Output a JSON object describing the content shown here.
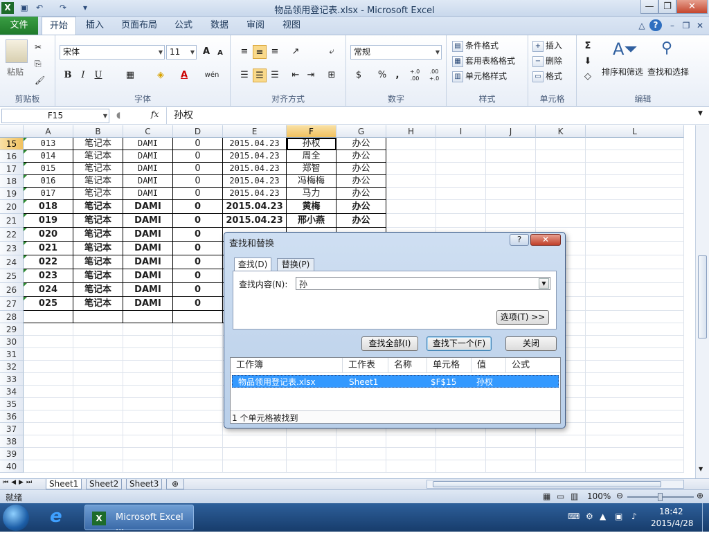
{
  "window": {
    "title": "物品领用登记表.xlsx - Microsoft Excel",
    "min_glyph": "—",
    "max_glyph": "❐",
    "close_glyph": "✕",
    "help_glyph": "?"
  },
  "ribbon_tabs": [
    "文件",
    "开始",
    "插入",
    "页面布局",
    "公式",
    "数据",
    "审阅",
    "视图"
  ],
  "ribbon": {
    "clipboard": {
      "label": "剪贴板",
      "paste": "粘贴"
    },
    "font": {
      "label": "字体",
      "font_name": "宋体",
      "font_size": "11",
      "bold": "B",
      "italic": "I",
      "underline": "U",
      "grow": "A",
      "shrink": "A",
      "font_color": "A",
      "phonetic": "wén"
    },
    "alignment": {
      "label": "对齐方式"
    },
    "number": {
      "label": "数字",
      "format": "常规",
      "percent": "%",
      "comma": ",",
      "inc_dec": "+.0 .00",
      "dec_dec": ".00 +.0"
    },
    "styles": {
      "label": "样式",
      "conditional": "条件格式",
      "table": "套用表格格式",
      "cell": "单元格样式"
    },
    "cells": {
      "label": "单元格",
      "insert": "插入",
      "delete": "删除",
      "format": "格式"
    },
    "editing": {
      "label": "编辑",
      "sum": "Σ",
      "sort": "排序和筛选",
      "find": "查找和选择"
    }
  },
  "formula_bar": {
    "name_box": "F15",
    "fx": "fx",
    "content": "孙权"
  },
  "columns": [
    "A",
    "B",
    "C",
    "D",
    "E",
    "F",
    "G",
    "H",
    "I",
    "J",
    "K",
    "L"
  ],
  "selected_column": "F",
  "rows": [
    {
      "n": "15",
      "cells": [
        "013",
        "笔记本",
        "DAMI",
        "0",
        "2015.04.23",
        "孙权",
        "办公"
      ],
      "bold": false
    },
    {
      "n": "16",
      "cells": [
        "014",
        "笔记本",
        "DAMI",
        "0",
        "2015.04.23",
        "周全",
        "办公"
      ],
      "bold": false
    },
    {
      "n": "17",
      "cells": [
        "015",
        "笔记本",
        "DAMI",
        "0",
        "2015.04.23",
        "郑智",
        "办公"
      ],
      "bold": false
    },
    {
      "n": "18",
      "cells": [
        "016",
        "笔记本",
        "DAMI",
        "0",
        "2015.04.23",
        "冯梅梅",
        "办公"
      ],
      "bold": false
    },
    {
      "n": "19",
      "cells": [
        "017",
        "笔记本",
        "DAMI",
        "0",
        "2015.04.23",
        "马力",
        "办公"
      ],
      "bold": false
    },
    {
      "n": "20",
      "cells": [
        "018",
        "笔记本",
        "DAMI",
        "0",
        "2015.04.23",
        "黄梅",
        "办公"
      ],
      "bold": true
    },
    {
      "n": "21",
      "cells": [
        "019",
        "笔记本",
        "DAMI",
        "0",
        "2015.04.23",
        "邢小燕",
        "办公"
      ],
      "bold": true
    },
    {
      "n": "22",
      "cells": [
        "020",
        "笔记本",
        "DAMI",
        "0",
        "",
        "",
        ""
      ],
      "bold": true
    },
    {
      "n": "23",
      "cells": [
        "021",
        "笔记本",
        "DAMI",
        "0",
        "",
        "",
        ""
      ],
      "bold": true
    },
    {
      "n": "24",
      "cells": [
        "022",
        "笔记本",
        "DAMI",
        "0",
        "",
        "",
        ""
      ],
      "bold": true
    },
    {
      "n": "25",
      "cells": [
        "023",
        "笔记本",
        "DAMI",
        "0",
        "",
        "",
        ""
      ],
      "bold": true
    },
    {
      "n": "26",
      "cells": [
        "024",
        "笔记本",
        "DAMI",
        "0",
        "",
        "",
        ""
      ],
      "bold": true
    },
    {
      "n": "27",
      "cells": [
        "025",
        "笔记本",
        "DAMI",
        "0",
        "",
        "",
        ""
      ],
      "bold": true
    },
    {
      "n": "28",
      "cells": [
        "",
        "",
        "",
        "",
        "",
        "",
        ""
      ],
      "bold": false
    },
    {
      "n": "29",
      "cells": [],
      "bold": false
    },
    {
      "n": "30",
      "cells": [],
      "bold": false
    },
    {
      "n": "31",
      "cells": [],
      "bold": false
    },
    {
      "n": "32",
      "cells": [],
      "bold": false
    },
    {
      "n": "33",
      "cells": [],
      "bold": false
    },
    {
      "n": "34",
      "cells": [],
      "bold": false
    },
    {
      "n": "35",
      "cells": [],
      "bold": false
    },
    {
      "n": "36",
      "cells": [],
      "bold": false
    },
    {
      "n": "37",
      "cells": [],
      "bold": false
    },
    {
      "n": "38",
      "cells": [],
      "bold": false
    },
    {
      "n": "39",
      "cells": [],
      "bold": false
    },
    {
      "n": "40",
      "cells": [],
      "bold": false
    }
  ],
  "sheets": [
    "Sheet1",
    "Sheet2",
    "Sheet3"
  ],
  "status": {
    "ready": "就绪",
    "zoom": "100%"
  },
  "taskbar": {
    "app": "Microsoft Excel ...",
    "time": "18:42",
    "date": "2015/4/28"
  },
  "dialog": {
    "title": "查找和替换",
    "tab_find": "查找(D)",
    "tab_replace": "替换(P)",
    "find_label": "查找内容(N):",
    "find_value": "孙",
    "options_btn": "选项(T) >>",
    "find_all_btn": "查找全部(I)",
    "find_next_btn": "查找下一个(F)",
    "close_btn": "关闭",
    "result_headers": [
      "工作簿",
      "工作表",
      "名称",
      "单元格",
      "值",
      "公式"
    ],
    "result_row": [
      "物品领用登记表.xlsx",
      "Sheet1",
      "",
      "$F$15",
      "孙权",
      ""
    ],
    "found_text": "1 个单元格被找到"
  },
  "colors": {
    "selection": "#3399ff",
    "file_tab": "#2a8a35"
  }
}
